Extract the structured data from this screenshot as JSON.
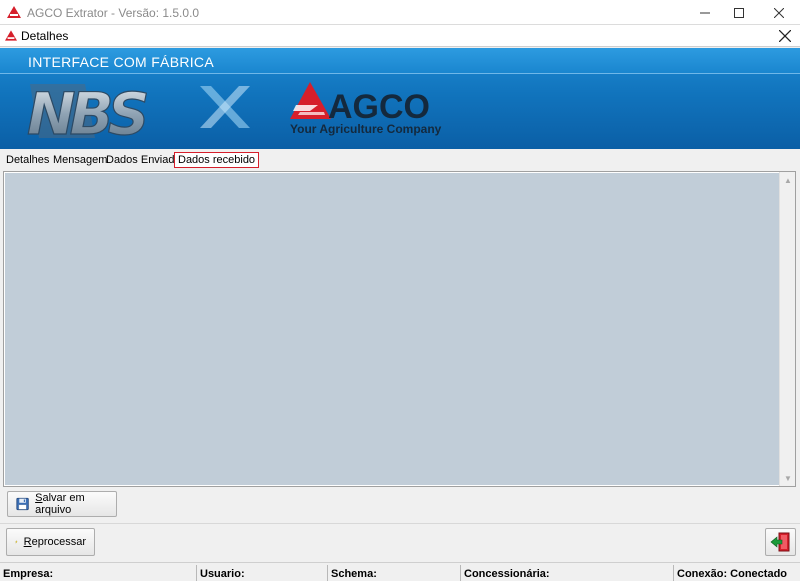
{
  "window": {
    "title": "AGCO Extrator - Versão: 1.5.0.0"
  },
  "child": {
    "title": "Detalhes"
  },
  "banner": {
    "title": "INTERFACE COM FÁBRICA",
    "logo_text": "NBS",
    "brand": "AGCO",
    "tagline": "Your Agriculture Company"
  },
  "tabs": [
    {
      "label": "Detalhes"
    },
    {
      "label": "Mensagem"
    },
    {
      "label": "Dados Enviado"
    },
    {
      "label": "Dados recebido"
    }
  ],
  "active_tab": "Dados recebido",
  "buttons": {
    "save": "Salvar em arquivo",
    "reprocess": "Reprocessar"
  },
  "status": {
    "empresa": "Empresa:",
    "usuario": "Usuario:",
    "schema": "Schema:",
    "concessionaria": "Concessionária:",
    "conexao": "Conexão: Conectado"
  },
  "colors": {
    "banner": "#1174bd",
    "content_bg": "#c1cdd8",
    "agco_red": "#d61f2b",
    "active_tab_border": "#d61f2b"
  }
}
